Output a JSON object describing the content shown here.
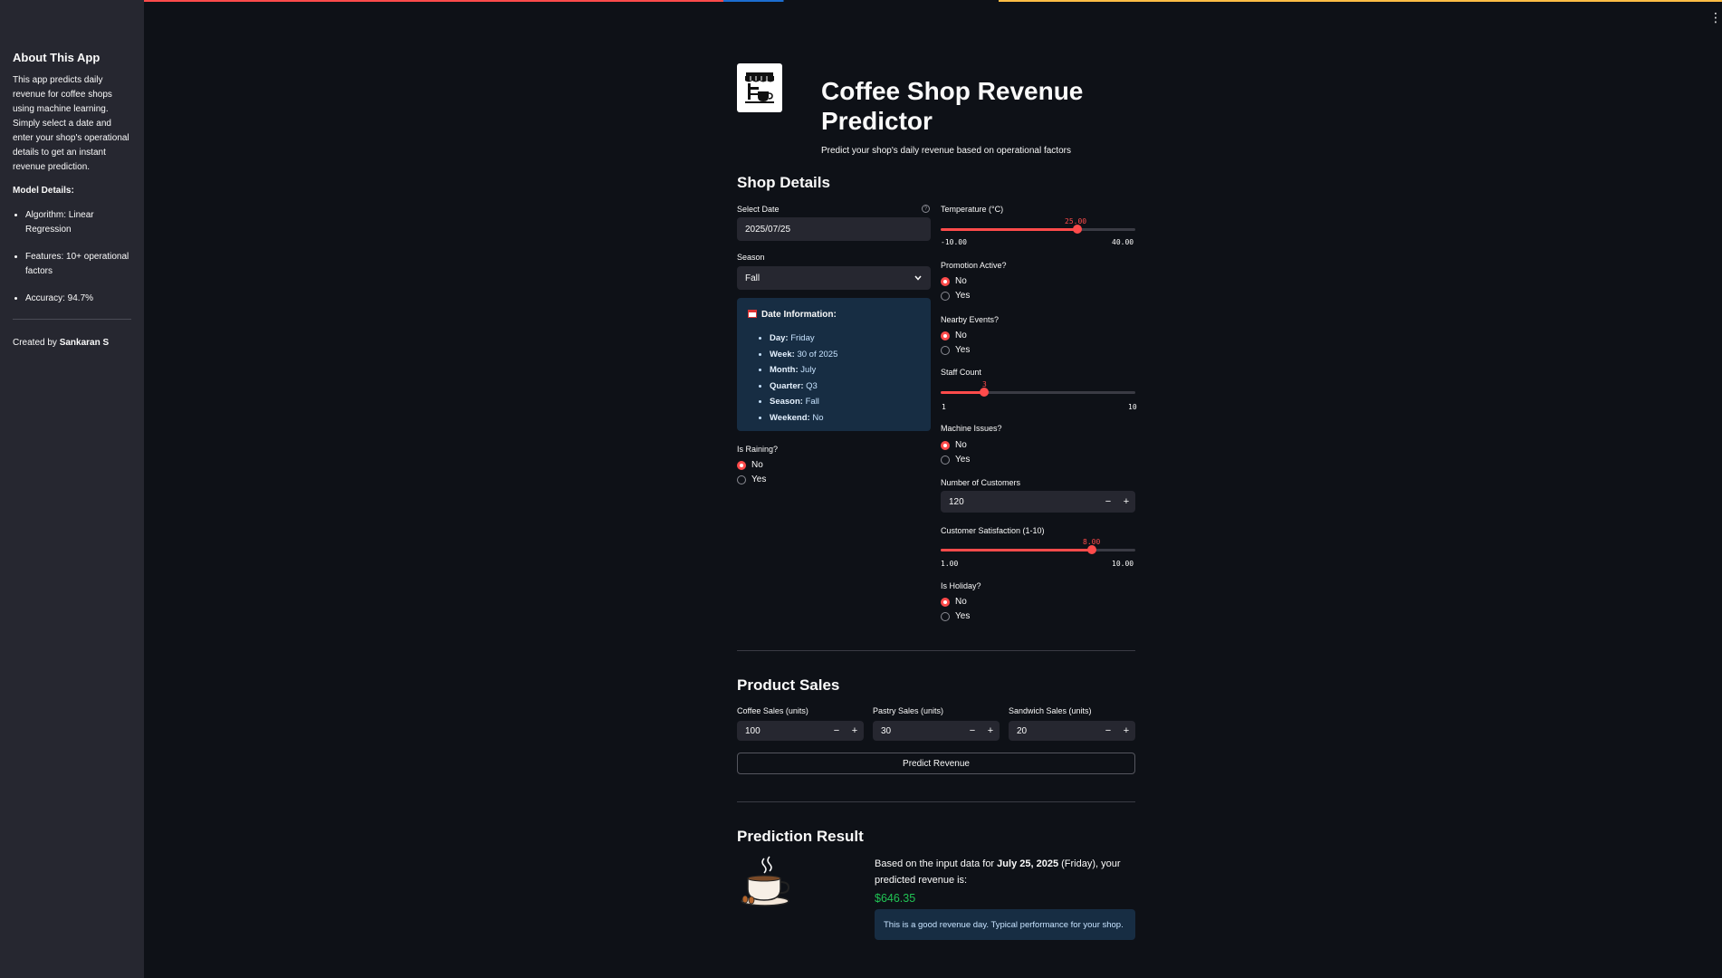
{
  "sidebar": {
    "title": "About This App",
    "description": "This app predicts daily revenue for coffee shops using machine learning. Simply select a date and enter your shop's operational details to get an instant revenue prediction.",
    "model_heading": "Model Details:",
    "model_items": [
      "Algorithm: Linear Regression",
      "Features: 10+ operational factors",
      "Accuracy: 94.7%"
    ],
    "credit_prefix": "Created by",
    "credit_name": "Sankaran S"
  },
  "header": {
    "title": "Coffee Shop Revenue Predictor",
    "subtitle": "Predict your shop's daily revenue based on operational factors",
    "logo_icon": "store-coffee-icon"
  },
  "shop_details": {
    "heading": "Shop Details",
    "date_label": "Select Date",
    "date_value": "2025/07/25",
    "season_label": "Season",
    "season_value": "Fall",
    "date_info": {
      "title": "Date Information:",
      "items": [
        {
          "key": "Day:",
          "value": "Friday"
        },
        {
          "key": "Week:",
          "value": "30 of 2025"
        },
        {
          "key": "Month:",
          "value": "July"
        },
        {
          "key": "Quarter:",
          "value": "Q3"
        },
        {
          "key": "Season:",
          "value": "Fall"
        },
        {
          "key": "Weekend:",
          "value": "No"
        }
      ]
    },
    "raining": {
      "label": "Is Raining?",
      "options": [
        "No",
        "Yes"
      ],
      "selected": "No"
    },
    "temperature": {
      "label": "Temperature (°C)",
      "value": "25.00",
      "min": "-10.00",
      "max": "40.00",
      "fraction": 0.7
    },
    "promotion": {
      "label": "Promotion Active?",
      "options": [
        "No",
        "Yes"
      ],
      "selected": "No"
    },
    "events": {
      "label": "Nearby Events?",
      "options": [
        "No",
        "Yes"
      ],
      "selected": "No"
    },
    "staff": {
      "label": "Staff Count",
      "value": "3",
      "min": "1",
      "max": "10",
      "fraction": 0.222
    },
    "machine": {
      "label": "Machine Issues?",
      "options": [
        "No",
        "Yes"
      ],
      "selected": "No"
    },
    "customers": {
      "label": "Number of Customers",
      "value": "120"
    },
    "satisfaction": {
      "label": "Customer Satisfaction (1-10)",
      "value": "8.00",
      "min": "1.00",
      "max": "10.00",
      "fraction": 0.778
    },
    "holiday": {
      "label": "Is Holiday?",
      "options": [
        "No",
        "Yes"
      ],
      "selected": "No"
    }
  },
  "product_sales": {
    "heading": "Product Sales",
    "coffee": {
      "label": "Coffee Sales (units)",
      "value": "100"
    },
    "pastry": {
      "label": "Pastry Sales (units)",
      "value": "30"
    },
    "sandwich": {
      "label": "Sandwich Sales (units)",
      "value": "20"
    },
    "predict_button": "Predict Revenue"
  },
  "result": {
    "heading": "Prediction Result",
    "text_prefix": "Based on the input data for",
    "date_bold": "July 25, 2025",
    "text_suffix": "(Friday), your predicted revenue is:",
    "value": "$646.35",
    "note": "This is a good revenue day. Typical performance for your shop."
  },
  "colors": {
    "accent": "#ff4b4b",
    "success": "#21c354",
    "info_bg": "#172d43",
    "sidebar_bg": "#262730",
    "page_bg": "#0e1117"
  }
}
